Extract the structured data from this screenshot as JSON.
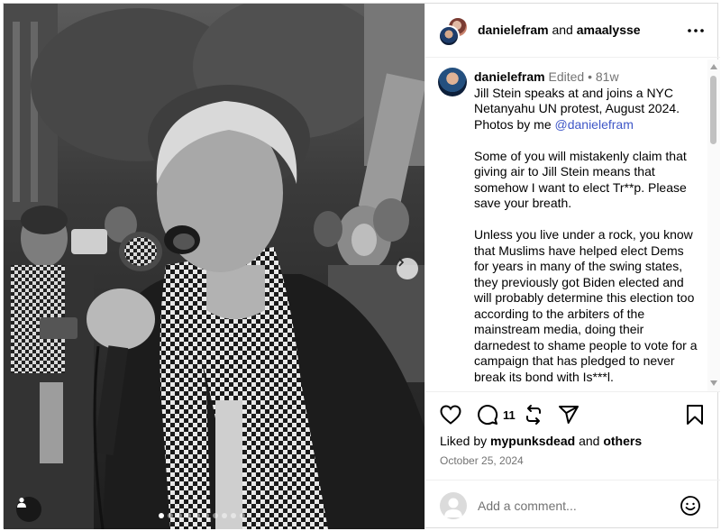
{
  "header": {
    "user1": "danielefram",
    "conj": " and ",
    "user2": "amaalysse"
  },
  "caption": {
    "username": "danielefram",
    "edited": "Edited",
    "dot": " • ",
    "age": "81w",
    "line1": "Jill Stein speaks at and joins a NYC Netanyahu UN protest, August 2024. Photos by me ",
    "mention": "@danielefram",
    "para2": "Some of you will mistakenly claim that giving air to Jill Stein means that somehow I want to elect Tr**p. Please save your breath.",
    "para3": "Unless you live under a rock, you know that Muslims have helped elect Dems for years in many of the swing states, they previously got Biden elected and will probably determine this election too according to the arbiters of the mainstream media, doing their darnedest to shame people to vote for a campaign that has pledged to never break its bond with Is***l."
  },
  "actions": {
    "comment_count": "11"
  },
  "likes": {
    "prefix": "Liked by ",
    "user": "mypunksdead",
    "mid": " and ",
    "others": "others"
  },
  "date": "October 25, 2024",
  "comment_input": {
    "placeholder": "Add a comment..."
  },
  "carousel": {
    "total": 10,
    "active": 0
  },
  "icons": [
    "more-icon",
    "heart-icon",
    "comment-icon",
    "repost-icon",
    "share-icon",
    "bookmark-icon",
    "emoji-icon",
    "user-tag-icon",
    "chevron-right-icon"
  ]
}
